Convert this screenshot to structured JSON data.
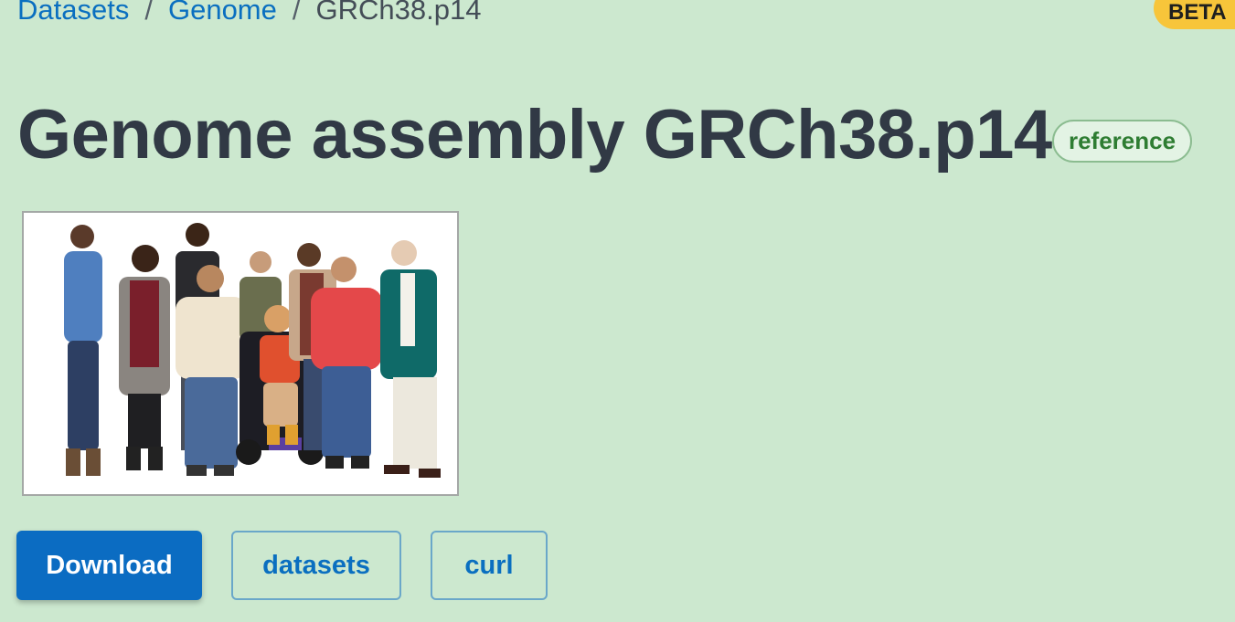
{
  "breadcrumb": {
    "items": [
      "Datasets",
      "Genome"
    ],
    "current": "GRCh38.p14",
    "separator": "/"
  },
  "badge": {
    "beta": "BETA"
  },
  "page": {
    "title": "Genome assembly GRCh38.p14",
    "tag": "reference"
  },
  "image": {
    "subject": "group-photo-of-people"
  },
  "actions": {
    "download": "Download",
    "datasets": "datasets",
    "curl": "curl"
  },
  "colors": {
    "background": "#cce8cf",
    "link": "#0a6fc0",
    "primary_button": "#0b6cc2",
    "beta_badge": "#f7c53a",
    "tag_text": "#2e7d32"
  }
}
